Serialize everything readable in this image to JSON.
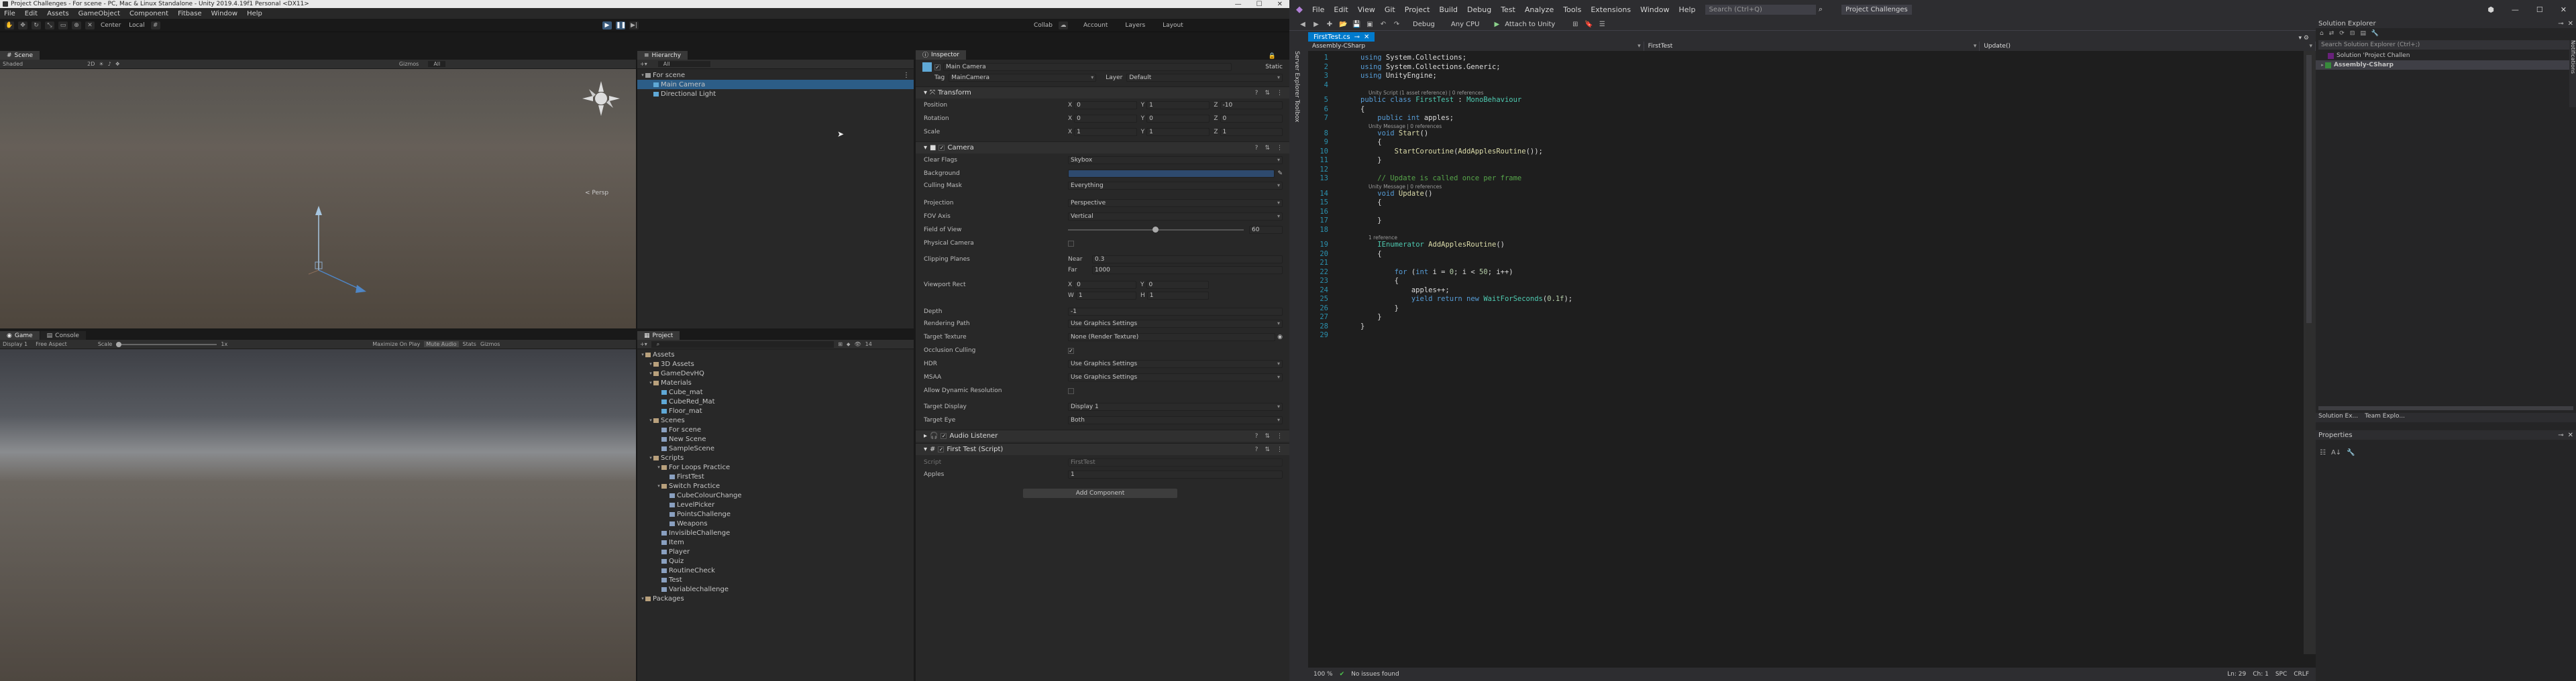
{
  "unity": {
    "title": "Project Challenges - For scene - PC, Mac & Linux Standalone - Unity 2019.4.19f1 Personal <DX11>",
    "menu": [
      "File",
      "Edit",
      "Assets",
      "GameObject",
      "Component",
      "Fitbase",
      "Window",
      "Help"
    ],
    "toolbar": {
      "pivot": "Center",
      "space": "Local",
      "collab": "Collab",
      "account": "Account",
      "layers": "Layers",
      "layout": "Layout"
    },
    "scene_tab": "Scene",
    "scene_tools": {
      "shading": "Shaded",
      "mode": "2D",
      "gizmos": "Gizmos",
      "search": "All",
      "persp": "< Persp"
    },
    "game_tab": "Game",
    "console_tab": "Console",
    "game_tools": {
      "display": "Display 1",
      "aspect": "Free Aspect",
      "scale": "Scale",
      "scale_value": "1x",
      "maximize": "Maximize On Play",
      "mute": "Mute Audio",
      "stats": "Stats",
      "gizmos": "Gizmos"
    },
    "hierarchy": {
      "tab": "Hierarchy",
      "search": "All",
      "items": [
        {
          "label": "For scene",
          "depth": 0,
          "type": "scene"
        },
        {
          "label": "Main Camera",
          "depth": 1,
          "type": "obj",
          "selected": true
        },
        {
          "label": "Directional Light",
          "depth": 1,
          "type": "obj"
        }
      ]
    },
    "project": {
      "tab": "Project",
      "count": "14",
      "tree": [
        {
          "label": "Assets",
          "depth": 0,
          "type": "folder"
        },
        {
          "label": "3D Assets",
          "depth": 1,
          "type": "folder"
        },
        {
          "label": "GameDevHQ",
          "depth": 1,
          "type": "folder"
        },
        {
          "label": "Materials",
          "depth": 1,
          "type": "folder"
        },
        {
          "label": "Cube_mat",
          "depth": 2,
          "type": "mat"
        },
        {
          "label": "CubeRed_Mat",
          "depth": 2,
          "type": "mat"
        },
        {
          "label": "Floor_mat",
          "depth": 2,
          "type": "mat"
        },
        {
          "label": "Scenes",
          "depth": 1,
          "type": "folder"
        },
        {
          "label": "For scene",
          "depth": 2,
          "type": "scene"
        },
        {
          "label": "New Scene",
          "depth": 2,
          "type": "scene"
        },
        {
          "label": "SampleScene",
          "depth": 2,
          "type": "scene"
        },
        {
          "label": "Scripts",
          "depth": 1,
          "type": "folder"
        },
        {
          "label": "For Loops Practice",
          "depth": 2,
          "type": "folder"
        },
        {
          "label": "FirstTest",
          "depth": 3,
          "type": "script"
        },
        {
          "label": "Switch Practice",
          "depth": 2,
          "type": "folder"
        },
        {
          "label": "CubeColourChange",
          "depth": 3,
          "type": "script"
        },
        {
          "label": "LevelPicker",
          "depth": 3,
          "type": "script"
        },
        {
          "label": "PointsChallenge",
          "depth": 3,
          "type": "script"
        },
        {
          "label": "Weapons",
          "depth": 3,
          "type": "script"
        },
        {
          "label": "InvisibleChallenge",
          "depth": 2,
          "type": "script"
        },
        {
          "label": "Item",
          "depth": 2,
          "type": "script"
        },
        {
          "label": "Player",
          "depth": 2,
          "type": "script"
        },
        {
          "label": "Quiz",
          "depth": 2,
          "type": "script"
        },
        {
          "label": "RoutineCheck",
          "depth": 2,
          "type": "script"
        },
        {
          "label": "Test",
          "depth": 2,
          "type": "script"
        },
        {
          "label": "Variablechallenge",
          "depth": 2,
          "type": "script"
        },
        {
          "label": "Packages",
          "depth": 0,
          "type": "folder"
        }
      ]
    },
    "inspector": {
      "tab": "Inspector",
      "object_name": "Main Camera",
      "static": "Static",
      "tag_label": "Tag",
      "tag": "MainCamera",
      "layer_label": "Layer",
      "layer": "Default",
      "transform": {
        "title": "Transform",
        "position": {
          "label": "Position",
          "x": "0",
          "y": "1",
          "z": "-10"
        },
        "rotation": {
          "label": "Rotation",
          "x": "0",
          "y": "0",
          "z": "0"
        },
        "scale": {
          "label": "Scale",
          "x": "1",
          "y": "1",
          "z": "1"
        }
      },
      "camera": {
        "title": "Camera",
        "clear_flags": {
          "label": "Clear Flags",
          "value": "Skybox"
        },
        "background": {
          "label": "Background"
        },
        "culling_mask": {
          "label": "Culling Mask",
          "value": "Everything"
        },
        "projection": {
          "label": "Projection",
          "value": "Perspective"
        },
        "fov_axis": {
          "label": "FOV Axis",
          "value": "Vertical"
        },
        "fov": {
          "label": "Field of View",
          "value": "60"
        },
        "physical": {
          "label": "Physical Camera"
        },
        "clipping": {
          "label": "Clipping Planes",
          "near_label": "Near",
          "near": "0.3",
          "far_label": "Far",
          "far": "1000"
        },
        "viewport": {
          "label": "Viewport Rect",
          "x": "0",
          "y": "0",
          "w": "1",
          "h": "1"
        },
        "depth": {
          "label": "Depth",
          "value": "-1"
        },
        "rendering_path": {
          "label": "Rendering Path",
          "value": "Use Graphics Settings"
        },
        "target_texture": {
          "label": "Target Texture",
          "value": "None (Render Texture)"
        },
        "occlusion": {
          "label": "Occlusion Culling"
        },
        "hdr": {
          "label": "HDR",
          "value": "Use Graphics Settings"
        },
        "msaa": {
          "label": "MSAA",
          "value": "Use Graphics Settings"
        },
        "dynamic_res": {
          "label": "Allow Dynamic Resolution"
        },
        "target_display": {
          "label": "Target Display",
          "value": "Display 1"
        },
        "target_eye": {
          "label": "Target Eye",
          "value": "Both"
        }
      },
      "audio_listener": "Audio Listener",
      "script": {
        "title": "First Test (Script)",
        "script_label": "Script",
        "script_value": "FirstTest",
        "apples_label": "Apples",
        "apples_value": "1"
      },
      "add_component": "Add Component"
    }
  },
  "vs": {
    "menu": [
      "File",
      "Edit",
      "View",
      "Git",
      "Project",
      "Build",
      "Debug",
      "Test",
      "Analyze",
      "Tools",
      "Extensions",
      "Window",
      "Help"
    ],
    "search": "Search (Ctrl+Q)",
    "project_name": "Project Challenges",
    "toolbar": {
      "config": "Debug",
      "platform": "Any CPU",
      "attach": "Attach to Unity"
    },
    "tab": "FirstTest.cs",
    "nav": {
      "project": "Assembly-CSharp",
      "class": "FirstTest",
      "member": "Update()"
    },
    "code": [
      {
        "n": "1",
        "t": "<span class='kw'>using</span> System.Collections;"
      },
      {
        "n": "2",
        "t": "<span class='kw'>using</span> System.Collections.Generic;"
      },
      {
        "n": "3",
        "t": "<span class='kw'>using</span> UnityEngine;"
      },
      {
        "n": "4",
        "t": ""
      },
      {
        "n": "5",
        "t": "<span class='kw'>public class</span> <span class='ty'>FirstTest</span> : <span class='ty'>MonoBehaviour</span>",
        "lens": "Unity Script (1 asset reference) | 0 references"
      },
      {
        "n": "6",
        "t": "{"
      },
      {
        "n": "7",
        "t": "    <span class='kw'>public int</span> apples;"
      },
      {
        "n": "8",
        "t": "    <span class='kw'>void</span> <span class='mt'>Start</span>()",
        "lens": "Unity Message | 0 references"
      },
      {
        "n": "9",
        "t": "    {"
      },
      {
        "n": "10",
        "t": "        <span class='mt'>StartCoroutine</span>(<span class='mt'>AddApplesRoutine</span>());"
      },
      {
        "n": "11",
        "t": "    }"
      },
      {
        "n": "12",
        "t": ""
      },
      {
        "n": "13",
        "t": "    <span class='cm'>// Update is called once per frame</span>"
      },
      {
        "n": "14",
        "t": "    <span class='kw'>void</span> <span class='mt'>Update</span>()",
        "lens": "Unity Message | 0 references"
      },
      {
        "n": "15",
        "t": "    {"
      },
      {
        "n": "16",
        "t": ""
      },
      {
        "n": "17",
        "t": "    }"
      },
      {
        "n": "18",
        "t": ""
      },
      {
        "n": "19",
        "t": "    <span class='ty'>IEnumerator</span> <span class='mt'>AddApplesRoutine</span>()",
        "lens": "1 reference"
      },
      {
        "n": "20",
        "t": "    {"
      },
      {
        "n": "21",
        "t": ""
      },
      {
        "n": "22",
        "t": "        <span class='kw'>for</span> (<span class='kw'>int</span> i = <span class='nm'>0</span>; i &lt; <span class='nm'>50</span>; i++)"
      },
      {
        "n": "23",
        "t": "        {"
      },
      {
        "n": "24",
        "t": "            apples++;"
      },
      {
        "n": "25",
        "t": "            <span class='kw'>yield return new</span> <span class='ty'>WaitForSeconds</span>(<span class='nm'>0.1f</span>);"
      },
      {
        "n": "26",
        "t": "        }"
      },
      {
        "n": "27",
        "t": "    }"
      },
      {
        "n": "28",
        "t": "}"
      },
      {
        "n": "29",
        "t": ""
      }
    ],
    "status": {
      "zoom": "100 %",
      "issues": "No issues found",
      "ln": "Ln: 29",
      "ch": "Ch: 1",
      "spc": "SPC",
      "eol": "CRLF"
    },
    "solution_explorer": {
      "title": "Solution Explorer",
      "search": "Search Solution Explorer (Ctrl+;)",
      "solution": "Solution 'Project Challen",
      "project": "Assembly-CSharp",
      "tab1": "Solution Ex...",
      "tab2": "Team Explo..."
    },
    "properties": {
      "title": "Properties"
    },
    "side_tab": "Server Explorer  Toolbox",
    "right_tab": "Notifications"
  }
}
